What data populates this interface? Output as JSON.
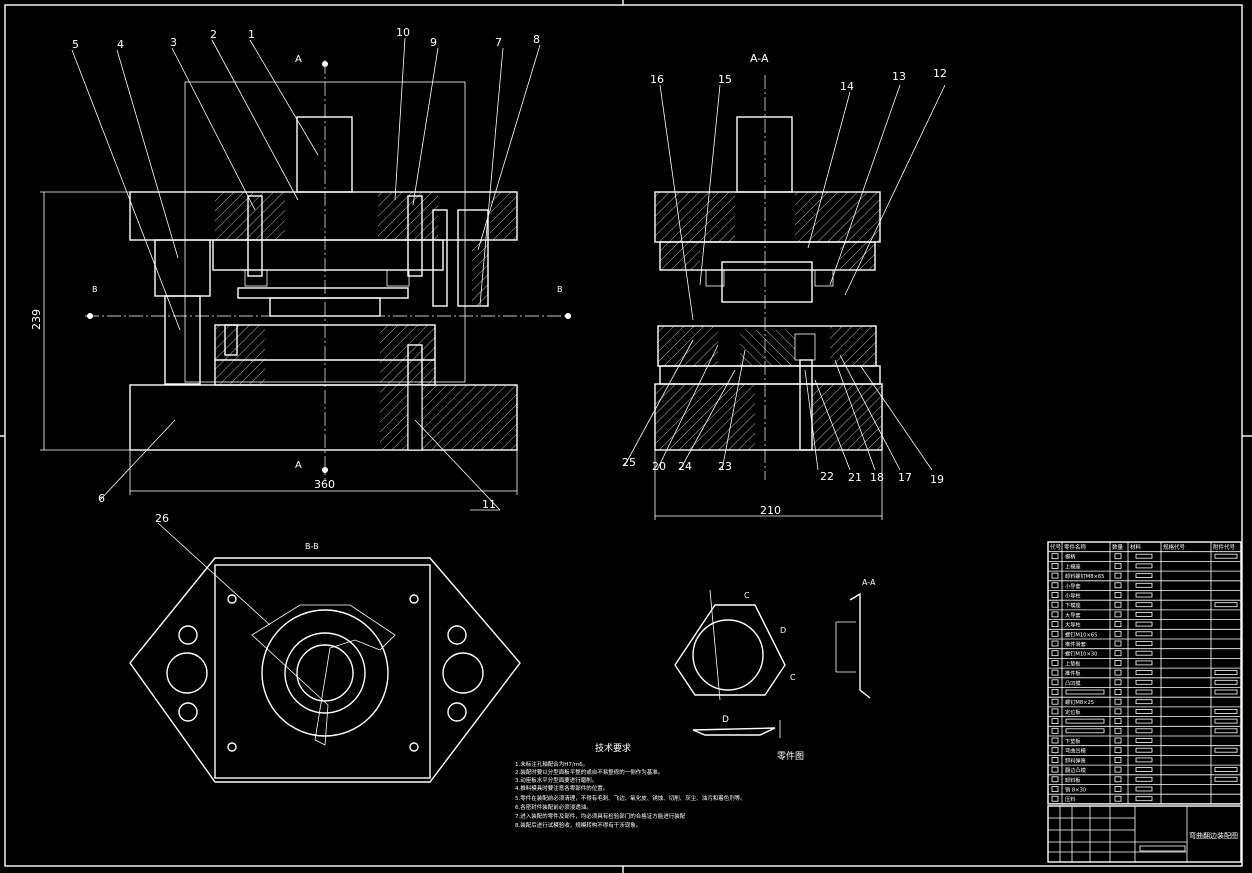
{
  "views": {
    "front_section_mark": "A",
    "side_view_title": "A-A",
    "plan_view_title": "B-B",
    "b_section_mark": "B",
    "part_drawing_title": "零件图",
    "part_section_title": "A-A",
    "part_label_c": "C",
    "part_label_d": "D"
  },
  "dimensions": {
    "front_width": "360",
    "front_height": "239",
    "side_width": "210"
  },
  "leaders_front": [
    "5",
    "4",
    "3",
    "2",
    "1",
    "10",
    "9",
    "7",
    "8",
    "6",
    "11"
  ],
  "leaders_side": [
    "16",
    "15",
    "14",
    "13",
    "12",
    "25",
    "20",
    "24",
    "23",
    "22",
    "21",
    "18",
    "17",
    "19"
  ],
  "leader_plan": "26",
  "tech_requirements": {
    "title": "技术要求",
    "items": [
      "1.未标注孔轴配合为H7/m6。",
      "2.装配时要以分型面板平整的或自不易整修的一侧作为基准。",
      "3.动座板水平分型面要进行磨削。",
      "4.推料模具时要注意各零部件的位置。",
      "5.零件在装配前必须清理，不得有毛刺、飞边、氧化皮、锈蚀、切削、灰尘、油污和着色剂等。",
      "6.各密封件装配前必须浸透油。",
      "7.进入装配的零件及部件，均必须具有检验部门的合格证方能进行装配",
      "8.装配后进行试模验收，规模转构不得有干涉现象。"
    ]
  },
  "parts_table": {
    "headers": [
      "代号",
      "零件名称",
      "数量",
      "材料",
      "规格代号",
      "附件代号"
    ],
    "rows": [
      "模柄",
      "上模座",
      "卸料螺钉M8×65",
      "小导套",
      "小导柱",
      "下模座",
      "大导套",
      "大导柱",
      "螺钉M10×65",
      "推件滑套",
      "螺钉M10×30",
      "上垫板",
      "推件板",
      "凸凹模",
      "",
      "螺钉M8×25",
      "定位板",
      "",
      "",
      "下垫板",
      "弯曲凹模",
      "卸料弹簧",
      "翻边凸模",
      "卸料板",
      "销 8×30",
      "压料"
    ]
  },
  "title_block": {
    "drawing_name": "弯曲翻边装配图"
  }
}
